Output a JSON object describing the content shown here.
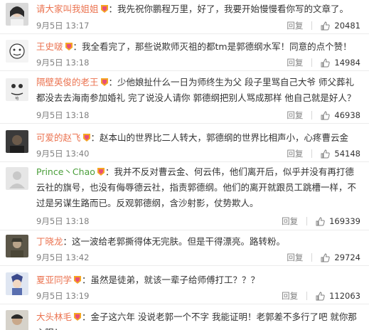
{
  "actions": {
    "reply_label": "回复"
  },
  "comments": [
    {
      "user": "请大家叫我姐姐",
      "user_color": "#eb7350",
      "text": "：我先祝你鹏程万里，好了，我要开始慢慢看你写的文章了。",
      "time": "9月5日 13:17",
      "likes": "20481",
      "avatar": "woman-portrait"
    },
    {
      "user": "王史啵",
      "user_color": "#eb7350",
      "text": "：我全看完了，那些说欺师灭祖的都tm是郭德纲水军！同意的点个赞！",
      "time": "9月5日 13:18",
      "likes": "14984",
      "avatar": "cartoon-face"
    },
    {
      "user": "隔壁英俊的老王",
      "user_color": "#eb7350",
      "text": "：少他娘扯什么一日为师终生为父 段子里骂自己大爷 师父葬礼都没去去海南参加婚礼 完了说没人请你 郭德纲把别人骂成那样 他自己就是好人？",
      "time": "9月5日 13:18",
      "likes": "46938",
      "avatar": "meme-face"
    },
    {
      "user": "可爱的赵飞",
      "user_color": "#eb7350",
      "text": "：赵本山的世界比二人转大，郭德纲的世界比相声小，心疼曹云金",
      "time": "9月5日 13:40",
      "likes": "54148",
      "avatar": "dark-photo"
    },
    {
      "user": "Prince丶Chao",
      "user_color": "#4a9e3a",
      "text": "：我并不反对曹云金、何云伟，他们离开后，似乎并没有再打德云社的旗号，也没有侮辱德云社，指责郭德纲。他们的离开就跟员工跳槽一样，不过是另谋生路而已。反观郭德纲，含沙射影，仗势欺人。",
      "time": "9月5日 13:18",
      "likes": "169339",
      "avatar": "blank-grey"
    },
    {
      "user": "丁晓龙",
      "user_color": "#eb7350",
      "text": "：这一波给老郭撕得体无完肤。但是干得漂亮。路转粉。",
      "time": "9月5日 13:42",
      "likes": "29724",
      "avatar": "soldier-photo"
    },
    {
      "user": "夏亚同学",
      "user_color": "#eb7350",
      "text": "：虽然是徒弟，就该一辈子给师傅打工？？？",
      "time": "9月5日 13:19",
      "likes": "112063",
      "avatar": "anime-char"
    },
    {
      "user": "大头林毛",
      "user_color": "#eb7350",
      "text": "：金子这六年 没说老郭一个不字 我能证明！老郭差不多行了吧 就你那心眼！",
      "time": "",
      "likes": "",
      "avatar": "man-photo"
    }
  ],
  "colors": {
    "username": "#eb7350",
    "meta": "#808080",
    "text": "#333333",
    "divider": "#ececec"
  }
}
